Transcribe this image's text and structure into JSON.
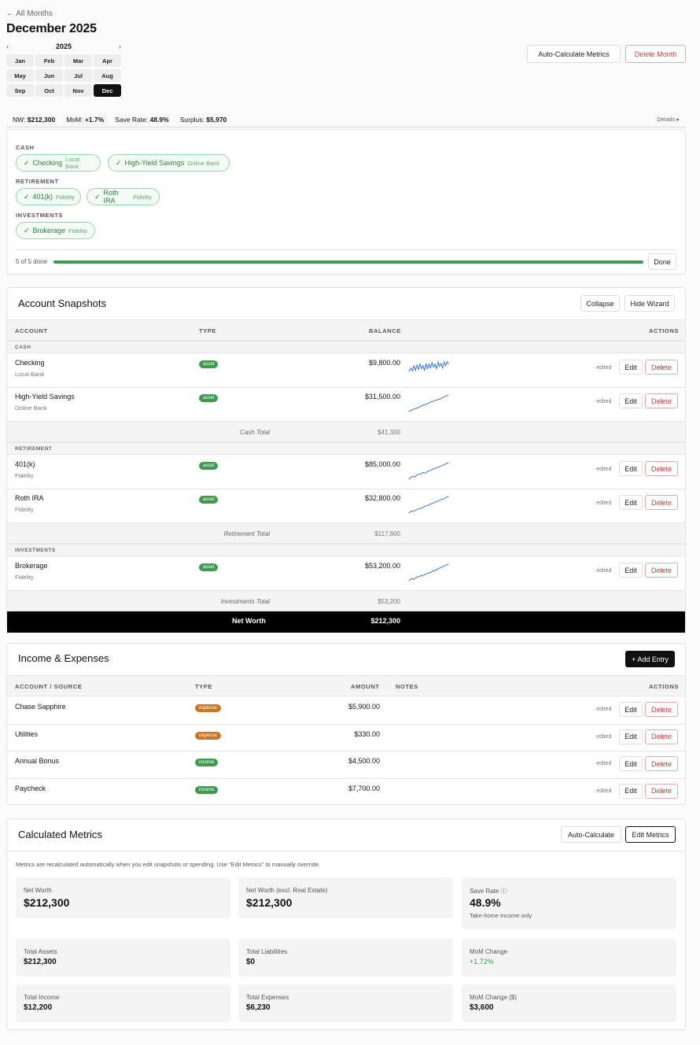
{
  "nav": {
    "back_label": "← All Months"
  },
  "page": {
    "title": "December 2025"
  },
  "picker": {
    "prev": "‹",
    "next": "›",
    "year": "2025",
    "months": [
      "Jan",
      "Feb",
      "Mar",
      "Apr",
      "May",
      "Jun",
      "Jul",
      "Aug",
      "Sep",
      "Oct",
      "Nov",
      "Dec"
    ],
    "selected": "Dec"
  },
  "header_actions": {
    "auto_calc": "Auto-Calculate Metrics",
    "delete_month": "Delete Month"
  },
  "summary": {
    "nw_label": "NW:",
    "nw_value": "$212,300",
    "mom_label": "MoM:",
    "mom_value": "+1.7%",
    "save_label": "Save Rate:",
    "save_value": "48.9%",
    "surplus_label": "Surplus:",
    "surplus_value": "$5,970",
    "details": "Details ▸"
  },
  "wizard": {
    "groups": [
      {
        "label": "CASH",
        "chips": [
          {
            "check": "✓",
            "name": "Checking",
            "sub": "Local Bank"
          },
          {
            "check": "✓",
            "name": "High-Yield Savings",
            "sub": "Online Bank"
          }
        ]
      },
      {
        "label": "RETIREMENT",
        "chips": [
          {
            "check": "✓",
            "name": "401(k)",
            "sub": "Fidelity"
          },
          {
            "check": "✓",
            "name": "Roth IRA",
            "sub": "Fidelity"
          }
        ]
      },
      {
        "label": "INVESTMENTS",
        "chips": [
          {
            "check": "✓",
            "name": "Brokerage",
            "sub": "Fidelity"
          }
        ]
      }
    ],
    "progress_text": "5 of 5 done",
    "progress_fraction": 1.0,
    "done_label": "Done"
  },
  "snapshots": {
    "title": "Account Snapshots",
    "collapse": "Collapse",
    "hide_wizard": "Hide Wizard",
    "headers": {
      "account": "ACCOUNT",
      "type": "TYPE",
      "balance": "BALANCE",
      "actions": "ACTIONS"
    },
    "categories": [
      {
        "label": "CASH",
        "total_label": "Cash Total",
        "total_value": "$41,300",
        "rows": [
          {
            "name": "Checking",
            "sub": "Local Bank",
            "type": "asset",
            "balance": "$9,800.00",
            "edited": "· edited",
            "edit": "Edit",
            "delete": "Delete"
          },
          {
            "name": "High-Yield Savings",
            "sub": "Online Bank",
            "type": "asset",
            "balance": "$31,500.00",
            "edited": "· edited",
            "edit": "Edit",
            "delete": "Delete"
          }
        ]
      },
      {
        "label": "RETIREMENT",
        "total_label": "Retirement Total",
        "total_value": "$117,800",
        "rows": [
          {
            "name": "401(k)",
            "sub": "Fidelity",
            "type": "asset",
            "balance": "$85,000.00",
            "edited": "· edited",
            "edit": "Edit",
            "delete": "Delete"
          },
          {
            "name": "Roth IRA",
            "sub": "Fidelity",
            "type": "asset",
            "balance": "$32,800.00",
            "edited": "· edited",
            "edit": "Edit",
            "delete": "Delete"
          }
        ]
      },
      {
        "label": "INVESTMENTS",
        "total_label": "Investments Total",
        "total_value": "$53,200",
        "rows": [
          {
            "name": "Brokerage",
            "sub": "Fidelity",
            "type": "asset",
            "balance": "$53,200.00",
            "edited": "· edited",
            "edit": "Edit",
            "delete": "Delete"
          }
        ]
      }
    ],
    "net_worth_label": "Net Worth",
    "net_worth_value": "$212,300"
  },
  "income": {
    "title": "Income & Expenses",
    "add_entry": "+ Add Entry",
    "headers": {
      "account": "ACCOUNT / SOURCE",
      "type": "TYPE",
      "amount": "AMOUNT",
      "notes": "NOTES",
      "actions": "ACTIONS"
    },
    "rows": [
      {
        "name": "Chase Sapphire",
        "type": "expense",
        "amount": "$5,900.00",
        "edited": "· edited",
        "edit": "Edit",
        "delete": "Delete"
      },
      {
        "name": "Utilities",
        "type": "expense",
        "amount": "$330.00",
        "edited": "· edited",
        "edit": "Edit",
        "delete": "Delete"
      },
      {
        "name": "Annual Bonus",
        "type": "income",
        "amount": "$4,500.00",
        "edited": "· edited",
        "edit": "Edit",
        "delete": "Delete"
      },
      {
        "name": "Paycheck",
        "type": "income",
        "amount": "$7,700.00",
        "edited": "· edited",
        "edit": "Edit",
        "delete": "Delete"
      }
    ]
  },
  "metrics": {
    "title": "Calculated Metrics",
    "auto_calc": "Auto-Calculate",
    "edit_metrics": "Edit Metrics",
    "note": "Metrics are recalculated automatically when you edit snapshots or spending. Use \"Edit Metrics\" to manually override.",
    "top": [
      {
        "label": "Net Worth",
        "value": "$212,300"
      },
      {
        "label": "Net Worth (excl. Real Estate)",
        "value": "$212,300"
      },
      {
        "label": "Save Rate ⓘ",
        "value": "48.9%",
        "note": "Take-home income only"
      }
    ],
    "grid": [
      {
        "label": "Total Assets",
        "value": "$212,300"
      },
      {
        "label": "Total Liabilities",
        "value": "$0"
      },
      {
        "label": "MoM Change",
        "value": "+1.72%",
        "color": "#3f9a4f"
      },
      {
        "label": "Total Income",
        "value": "$12,200"
      },
      {
        "label": "Total Expenses",
        "value": "$6,230"
      },
      {
        "label": "MoM Change ($)",
        "value": "$3,600"
      }
    ]
  }
}
